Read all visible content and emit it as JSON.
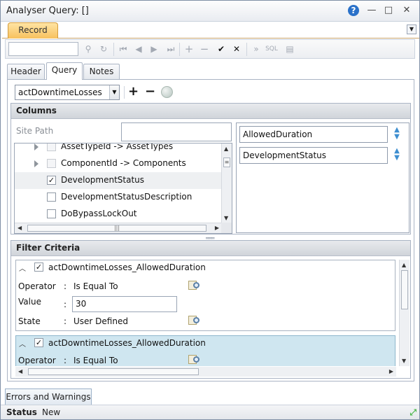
{
  "window": {
    "title": "Analyser Query: []"
  },
  "ribbon": {
    "tab_record": "Record"
  },
  "toolbar": {
    "search_placeholder": "",
    "buttons": [
      "search-icon",
      "refresh-icon",
      "first-icon",
      "prev-icon",
      "next-icon",
      "last-icon",
      "add-icon",
      "remove-icon",
      "confirm-icon",
      "cancel-icon",
      "forward-icon",
      "sql-icon",
      "grid-icon"
    ],
    "sql_label": "SQL"
  },
  "tabs": {
    "header": "Header",
    "query": "Query",
    "notes": "Notes"
  },
  "query": {
    "object_select": "actDowntimeLosses",
    "columns": {
      "title": "Columns",
      "site_path_label": "Site Path",
      "site_path_value": "",
      "tree_items": [
        {
          "label": "AssetTypeId -> AssetTypes",
          "expandable": true,
          "checked": false,
          "enabled": false
        },
        {
          "label": "ComponentId -> Components",
          "expandable": true,
          "checked": false,
          "enabled": false
        },
        {
          "label": "DevelopmentStatus",
          "expandable": false,
          "checked": true,
          "enabled": true
        },
        {
          "label": "DevelopmentStatusDescription",
          "expandable": false,
          "checked": false,
          "enabled": true
        },
        {
          "label": "DoBypassLockOut",
          "expandable": false,
          "checked": false,
          "enabled": true
        }
      ],
      "selected_columns": [
        "AllowedDuration",
        "DevelopmentStatus"
      ]
    },
    "filter": {
      "title": "Filter Criteria",
      "criteria": [
        {
          "name": "actDowntimeLosses_AllowedDuration",
          "operator_label": "Operator",
          "operator_value": "Is Equal To",
          "value_label": "Value",
          "value": "30",
          "state_label": "State",
          "state_value": "User Defined"
        },
        {
          "name": "actDowntimeLosses_AllowedDuration",
          "operator_label": "Operator",
          "operator_value": "Is Equal To"
        }
      ]
    }
  },
  "bottom": {
    "errors_tab": "Errors and Warnings",
    "status_label": "Status",
    "status_value": "New"
  },
  "colors": {
    "record_tab": "#f7c15e",
    "selected_criterion": "#cfe6f0",
    "accent_blue": "#2a71c9"
  }
}
